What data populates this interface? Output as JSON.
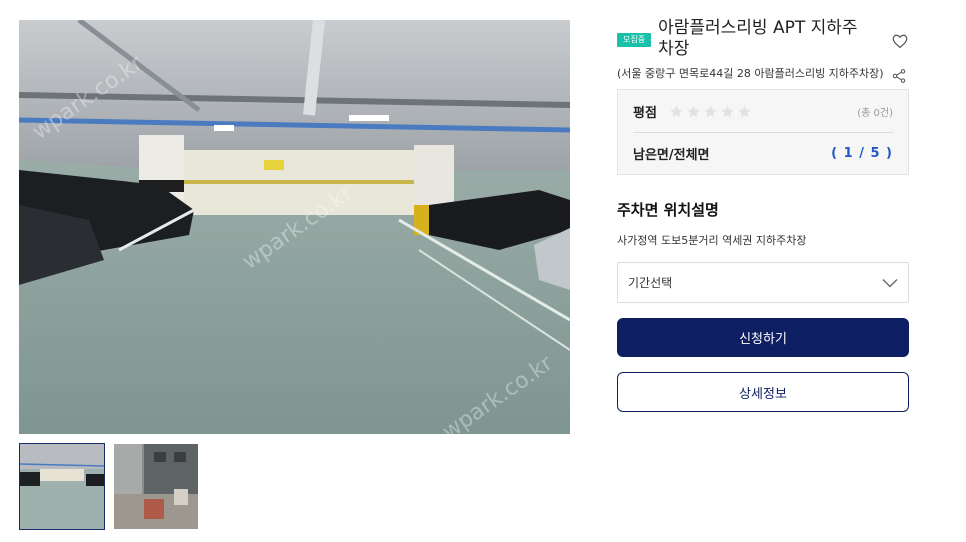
{
  "listing": {
    "badge": "모집중",
    "title": "아람플러스리빙 APT 지하주차장",
    "address": "(서울 중랑구 면목로44길 28 아람플러스리빙 지하주차장)"
  },
  "stats": {
    "rating_label": "평점",
    "rating_value": 0,
    "rating_max": 5,
    "rating_count": "(총 0건)",
    "spaces_label": "남은면/전체면",
    "spaces_value": "( 1 / 5 )"
  },
  "location": {
    "heading": "주차면 위치설명",
    "description": "사가정역 도보5분거리 역세권 지하주차장"
  },
  "period_select": {
    "selected": "기간선택"
  },
  "actions": {
    "apply_label": "신청하기",
    "details_label": "상세정보"
  },
  "gallery": {
    "watermark": "wpark.co.kr",
    "thumbnails": [
      "parking-garage-photo",
      "building-exterior-photo"
    ],
    "active_index": 0
  },
  "colors": {
    "badge": "#1bc0a8",
    "primary": "#0e1e62",
    "ratio": "#2156c8"
  }
}
